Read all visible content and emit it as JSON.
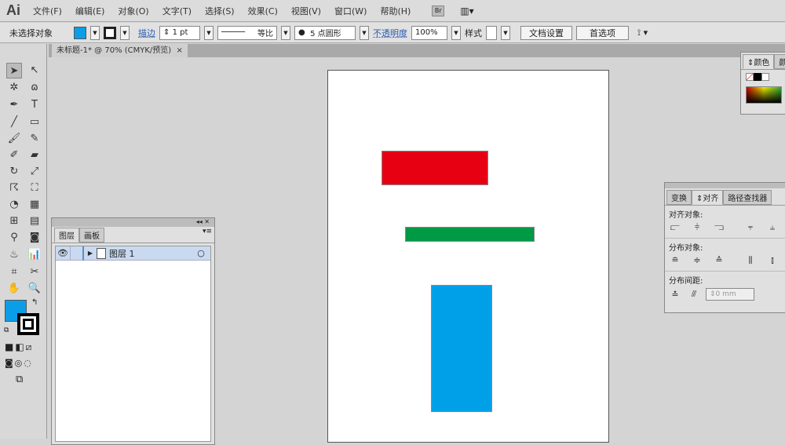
{
  "app": {
    "logo": "Ai"
  },
  "menu": [
    "文件(F)",
    "编辑(E)",
    "对象(O)",
    "文字(T)",
    "选择(S)",
    "效果(C)",
    "视图(V)",
    "窗口(W)",
    "帮助(H)"
  ],
  "bridge": "Br",
  "control": {
    "selection": "未选择对象",
    "stroke_label": "描边",
    "stroke_value": "1 pt",
    "profile": "等比",
    "brush": "5 点圆形",
    "opacity_label": "不透明度",
    "opacity_value": "100%",
    "style_label": "样式",
    "doc_setup": "文档设置",
    "preferences": "首选项",
    "fill_color": "#0b9ee8"
  },
  "document": {
    "tab": "未标题-1* @ 70% (CMYK/预览)",
    "close": "×"
  },
  "artwork": {
    "red": "#e60012",
    "green": "#009944",
    "blue": "#00a0e9"
  },
  "layers": {
    "tabs": [
      "图层",
      "画板"
    ],
    "layer_name": "图层 1"
  },
  "color_panel": {
    "tabs": [
      "颜色",
      "颜"
    ]
  },
  "align_panel": {
    "tabs": [
      "变换",
      "对齐",
      "路径查找器"
    ],
    "align_objects": "对齐对象:",
    "distribute_objects": "分布对象:",
    "distribute_spacing": "分布间距:",
    "spacing_value": "0 mm"
  }
}
